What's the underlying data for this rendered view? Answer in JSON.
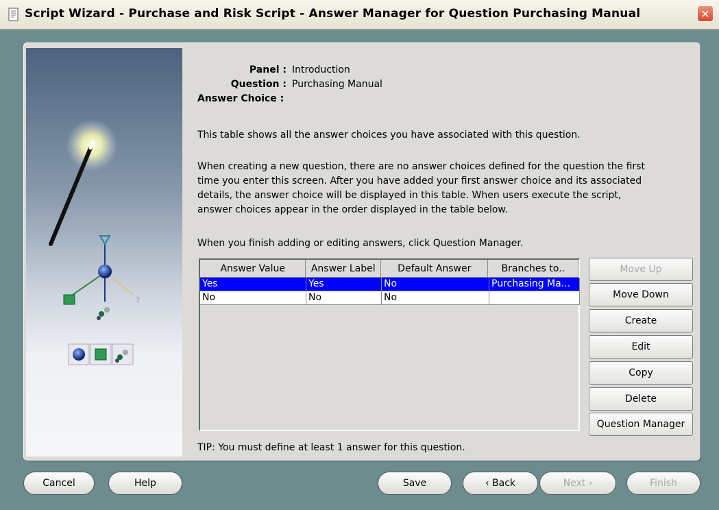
{
  "window": {
    "title": "Script Wizard - Purchase and Risk Script - Answer Manager for Question Purchasing Manual",
    "close_label": "✕"
  },
  "info": {
    "panel_label": "Panel :",
    "panel_value": "Introduction",
    "question_label": "Question :",
    "question_value": "Purchasing Manual",
    "answer_choice_label": "Answer Choice :"
  },
  "description": {
    "para1": "This table shows all the answer choices you have associated with this question.",
    "para2_lines": [
      "When creating a new question, there are no answer choices defined for the question the first",
      "time you enter this screen. After you have added your first answer choice and its associated",
      "details, the answer choice will be displayed in this table. When users execute the script,",
      "answer choices appear in the order displayed in the table below."
    ],
    "para3": "When you finish adding or editing answers, click Question Manager."
  },
  "table": {
    "columns": [
      "Answer Value",
      "Answer Label",
      "Default Answer",
      "Branches to.."
    ],
    "rows": [
      [
        "Yes",
        "Yes",
        "No",
        "Purchasing Ma..."
      ],
      [
        "No",
        "No",
        "No",
        ""
      ]
    ],
    "selected_row": 0
  },
  "side_buttons": {
    "move_up": "Move Up",
    "move_down": "Move Down",
    "create": "Create",
    "edit": "Edit",
    "copy": "Copy",
    "delete": "Delete",
    "question_manager": "Question Manager"
  },
  "tip": "TIP: You must define at least 1 answer for this question.",
  "bottom_buttons": {
    "cancel": "Cancel",
    "help": "Help",
    "save": "Save",
    "back": "Back",
    "next": "Next",
    "finish": "Finish"
  },
  "colors": {
    "selection": "#0000ff",
    "window_bg": "#6e8c8d",
    "panel_bg": "#dcdbd8"
  }
}
